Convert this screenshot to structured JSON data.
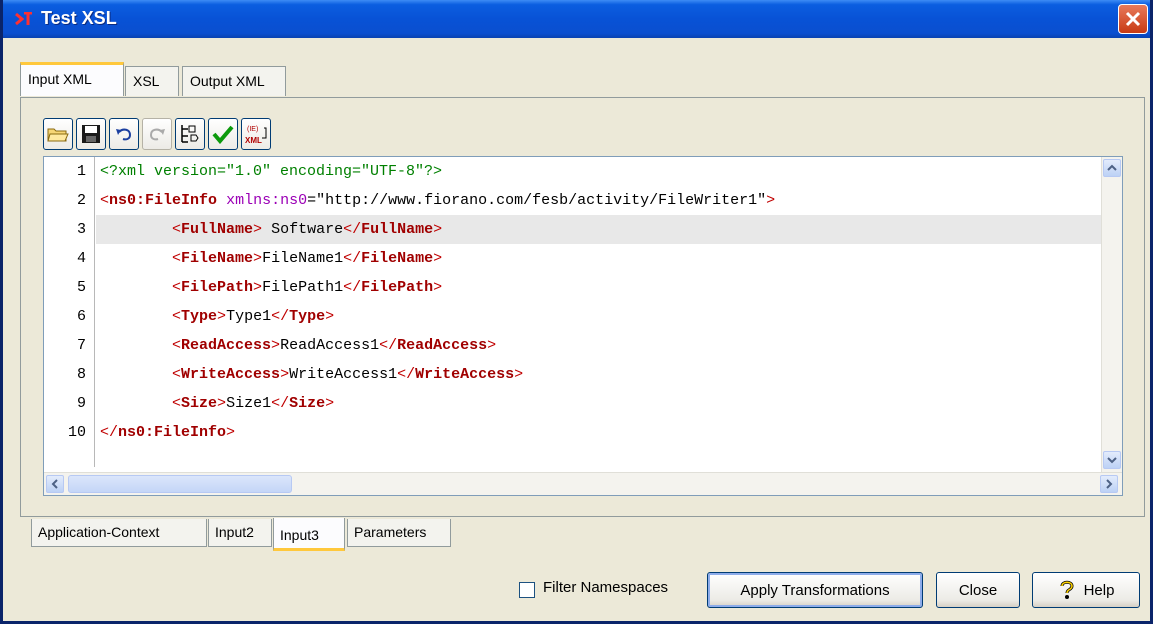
{
  "window": {
    "title": "Test XSL"
  },
  "top_tabs": [
    "Input XML",
    "XSL",
    "Output XML"
  ],
  "toolbar": {
    "buttons": [
      "open-folder-icon",
      "save-icon",
      "undo-icon",
      "redo-icon",
      "tree-view-icon",
      "validate-check-icon",
      "xml-entity-icon"
    ],
    "xml_icon_text": "XML",
    "entity_icon_text": "(IE)"
  },
  "editor": {
    "lines": [
      {
        "num": "1",
        "text": "<?xml version=\"1.0\" encoding=\"UTF-8\"?>"
      },
      {
        "num": "2",
        "text": "<ns0:FileInfo xmlns:ns0=\"http://www.fiorano.com/fesb/activity/FileWriter1\">"
      },
      {
        "num": "3",
        "text": "        <FullName> Software</FullName>"
      },
      {
        "num": "4",
        "text": "        <FileName>FileName1</FileName>"
      },
      {
        "num": "5",
        "text": "        <FilePath>FilePath1</FilePath>"
      },
      {
        "num": "6",
        "text": "        <Type>Type1</Type>"
      },
      {
        "num": "7",
        "text": "        <ReadAccess>ReadAccess1</ReadAccess>"
      },
      {
        "num": "8",
        "text": "        <WriteAccess>WriteAccess1</WriteAccess>"
      },
      {
        "num": "9",
        "text": "        <Size>Size1</Size>"
      },
      {
        "num": "10",
        "text": "</ns0:FileInfo>"
      }
    ],
    "highlighted_line": "3"
  },
  "bottom_tabs": [
    "Application-Context",
    "Input2",
    "Input3",
    "Parameters"
  ],
  "active_bottom_tab": "Input3",
  "footer": {
    "filter_label": "Filter Namespaces",
    "filter_checked": false,
    "apply_label": "Apply Transformations",
    "close_label": "Close",
    "help_label": "Help"
  },
  "colors": {
    "title_bar": "#0852d6",
    "tag": "#a00000",
    "attr": "#9b00b6",
    "active_tab_accent": "#ffc83c"
  }
}
